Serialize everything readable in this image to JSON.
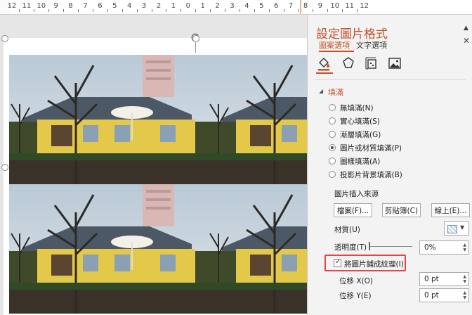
{
  "ruler": {
    "ticks": [
      "12",
      "11",
      "10",
      "9",
      "8",
      "7",
      "6",
      "5",
      "4",
      "3",
      "2",
      "1",
      "0",
      "1",
      "2",
      "3",
      "4",
      "5",
      "6",
      "7",
      "8",
      "9",
      "10",
      "11",
      "12"
    ]
  },
  "pane": {
    "title": "設定圖片格式",
    "tabs": [
      "圖案選項",
      "文字選項"
    ],
    "category_icons": [
      "fill-line-icon",
      "effects-pentagon-icon",
      "size-properties-icon",
      "picture-icon"
    ],
    "section": "填滿",
    "fill_options": [
      {
        "label": "無填滿(N)",
        "checked": false
      },
      {
        "label": "實心填滿(S)",
        "checked": false
      },
      {
        "label": "漸層填滿(G)",
        "checked": false
      },
      {
        "label": "圖片或材質填滿(P)",
        "checked": true
      },
      {
        "label": "圖樣填滿(A)",
        "checked": false
      },
      {
        "label": "投影片背景填滿(B)",
        "checked": false
      }
    ],
    "source_label": "圖片插入來源",
    "buttons": {
      "file": "檔案(F)...",
      "clipboard": "剪貼簿(C)",
      "online": "線上(E)..."
    },
    "texture_label": "材質(U)",
    "transparency_label": "透明度(T)",
    "transparency_value": "0%",
    "tile_checkbox": {
      "label": "將圖片鋪成紋理(I)",
      "checked": true
    },
    "offset_x_label": "位移 X(O)",
    "offset_x_value": "0 pt",
    "offset_y_label": "位移 Y(E)",
    "offset_y_value": "0 pt"
  }
}
